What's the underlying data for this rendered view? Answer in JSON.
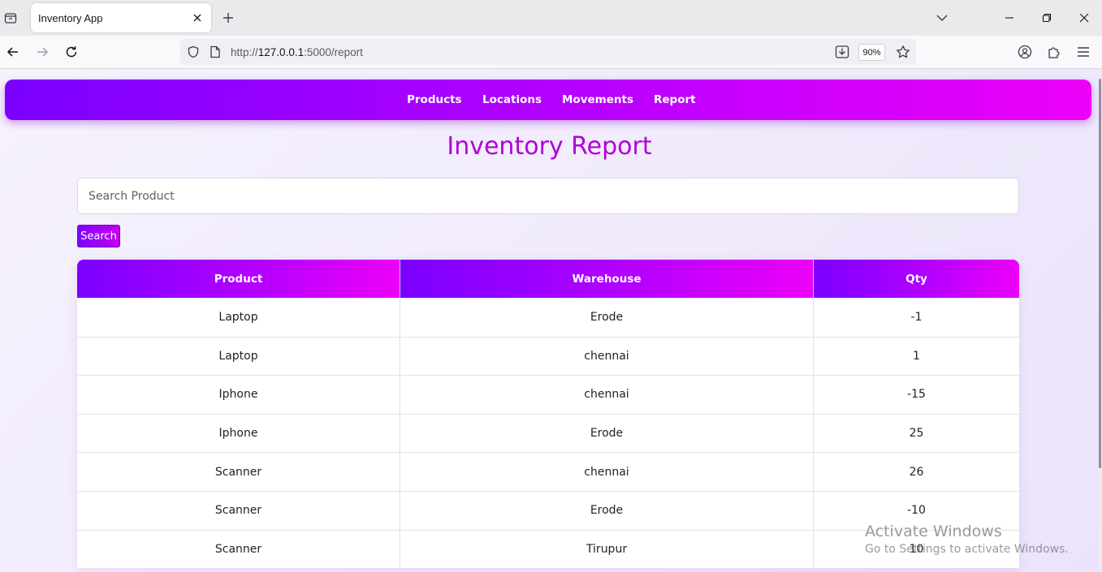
{
  "browser": {
    "tab_title": "Inventory App",
    "url_prefix": "http://",
    "url_host": "127.0.0.1",
    "url_path": ":5000/report",
    "zoom": "90%"
  },
  "nav": {
    "items": [
      "Products",
      "Locations",
      "Movements",
      "Report"
    ]
  },
  "page": {
    "title": "Inventory Report",
    "search_placeholder": "Search Product",
    "search_button": "Search"
  },
  "table": {
    "headers": [
      "Product",
      "Warehouse",
      "Qty"
    ],
    "rows": [
      [
        "Laptop",
        "Erode",
        "-1"
      ],
      [
        "Laptop",
        "chennai",
        "1"
      ],
      [
        "Iphone",
        "chennai",
        "-15"
      ],
      [
        "Iphone",
        "Erode",
        "25"
      ],
      [
        "Scanner",
        "chennai",
        "26"
      ],
      [
        "Scanner",
        "Erode",
        "-10"
      ],
      [
        "Scanner",
        "Tirupur",
        "10"
      ]
    ]
  },
  "watermark": {
    "title": "Activate Windows",
    "subtitle": "Go to Settings to activate Windows."
  },
  "colors": {
    "gradient_start": "#7b00ff",
    "gradient_end": "#ec00f8",
    "title": "#b000d8"
  }
}
